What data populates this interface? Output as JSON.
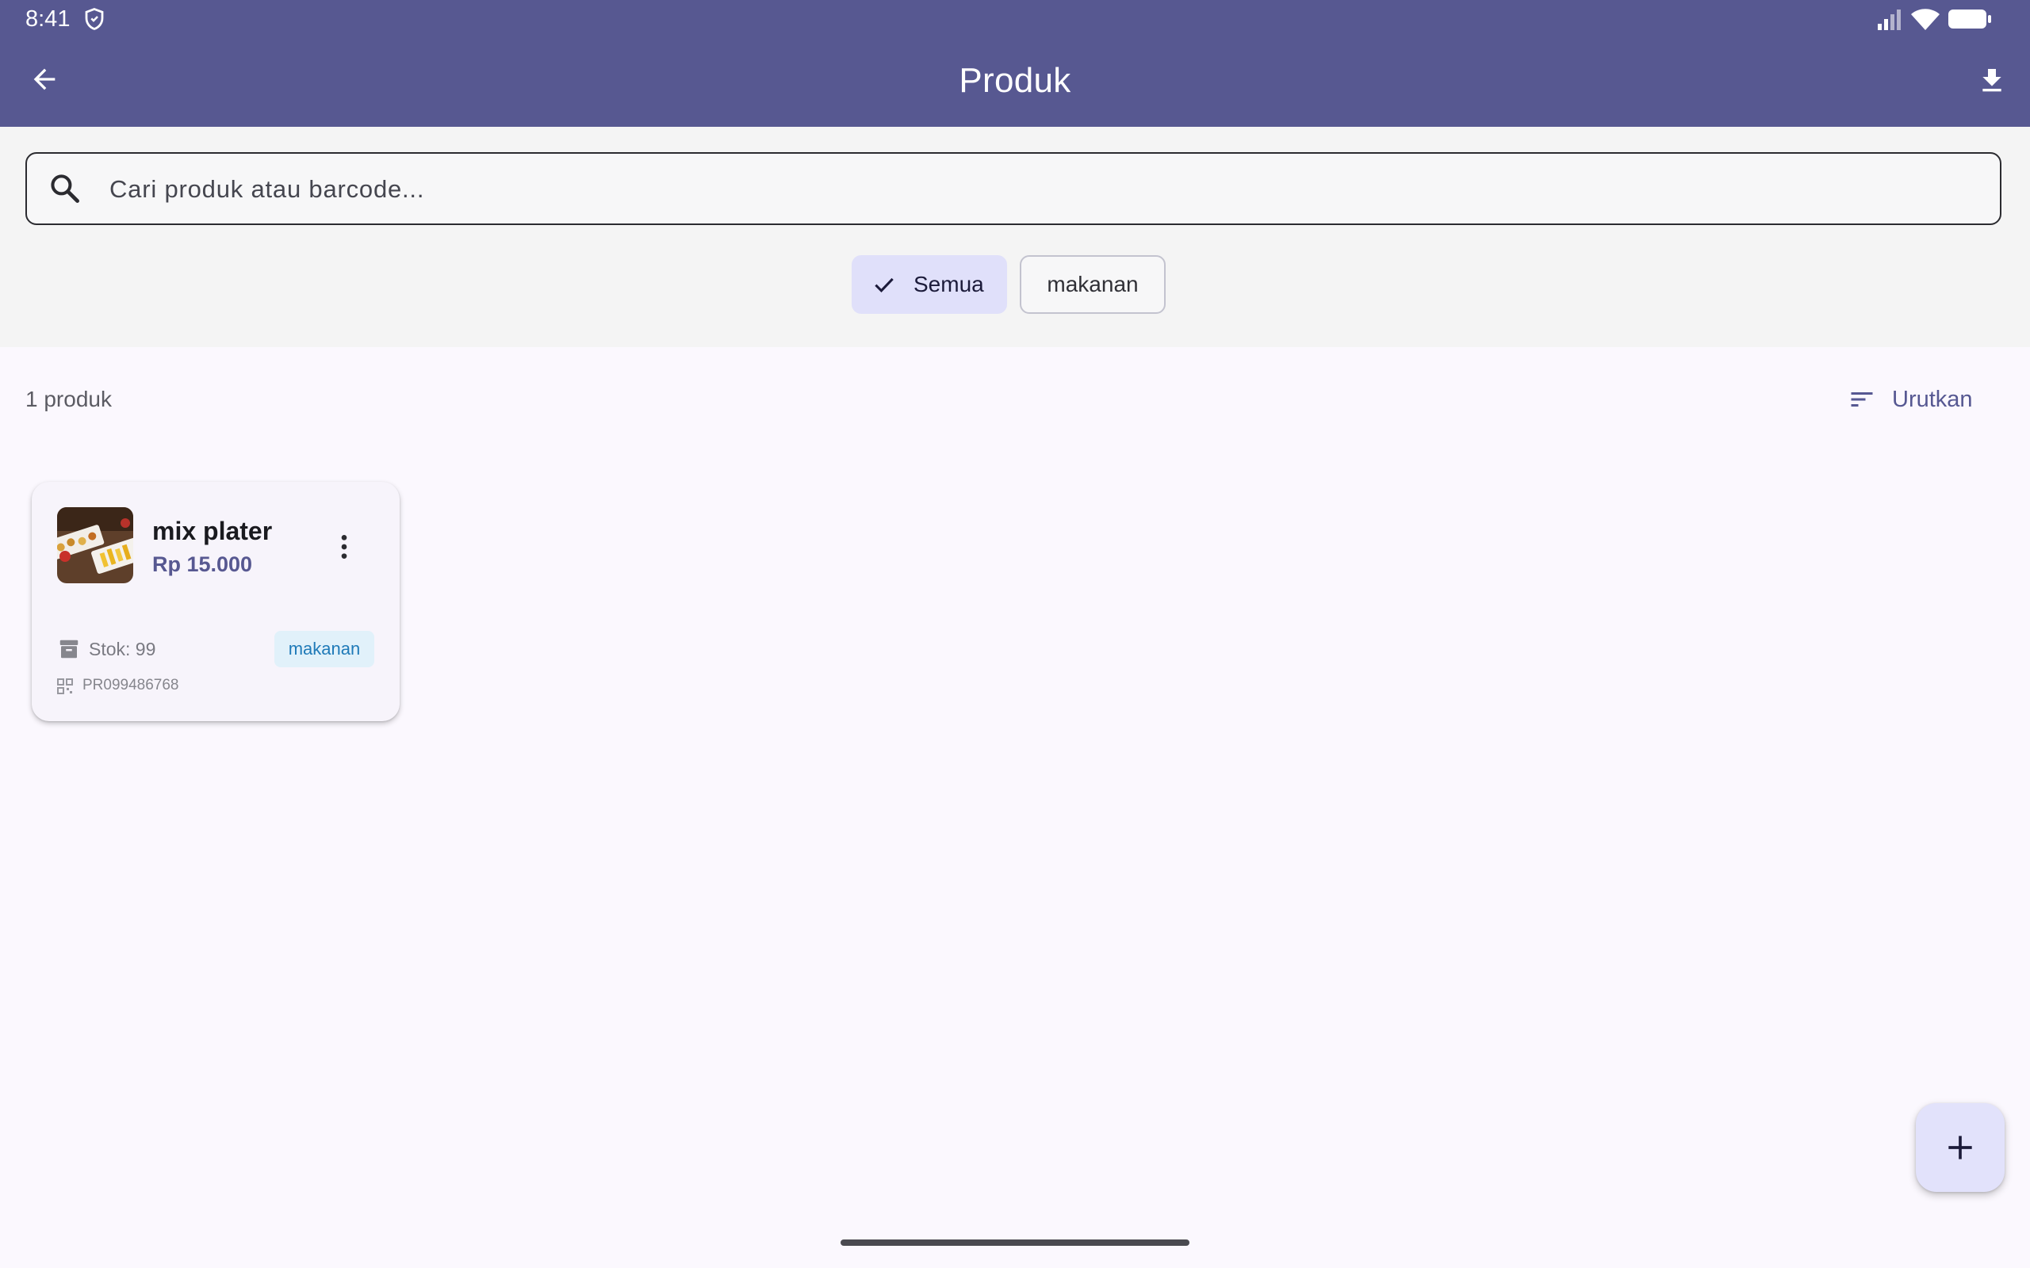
{
  "status_bar": {
    "time": "8:41",
    "icons": [
      "shield-icon",
      "signal-icon",
      "wifi-icon",
      "battery-icon"
    ]
  },
  "app_bar": {
    "title": "Produk",
    "back_icon": "arrow-left-icon",
    "action_icon": "download-icon",
    "color": "#575891"
  },
  "search": {
    "placeholder": "Cari produk atau barcode...",
    "value": "",
    "icon": "search-icon"
  },
  "filters": [
    {
      "label": "Semua",
      "selected": true,
      "icon": "check-icon"
    },
    {
      "label": "makanan",
      "selected": false
    }
  ],
  "list_header": {
    "count_text": "1 produk",
    "sort_label": "Urutkan",
    "sort_icon": "sort-icon"
  },
  "products": [
    {
      "name": "mix plater",
      "price": "Rp 15.000",
      "stock": "Stok: 99",
      "category": "makanan",
      "barcode": "PR099486768",
      "menu_icon": "more-vertical-icon",
      "stock_icon": "archive-box-icon",
      "barcode_icon": "qr-code-icon"
    }
  ],
  "fab": {
    "icon": "plus-icon"
  },
  "colors": {
    "primary": "#575891",
    "chip_selected_bg": "#e0e0fa",
    "badge_bg": "#e1f1fa",
    "badge_text": "#1f7ab8",
    "page_bg": "#fbf8fe"
  }
}
